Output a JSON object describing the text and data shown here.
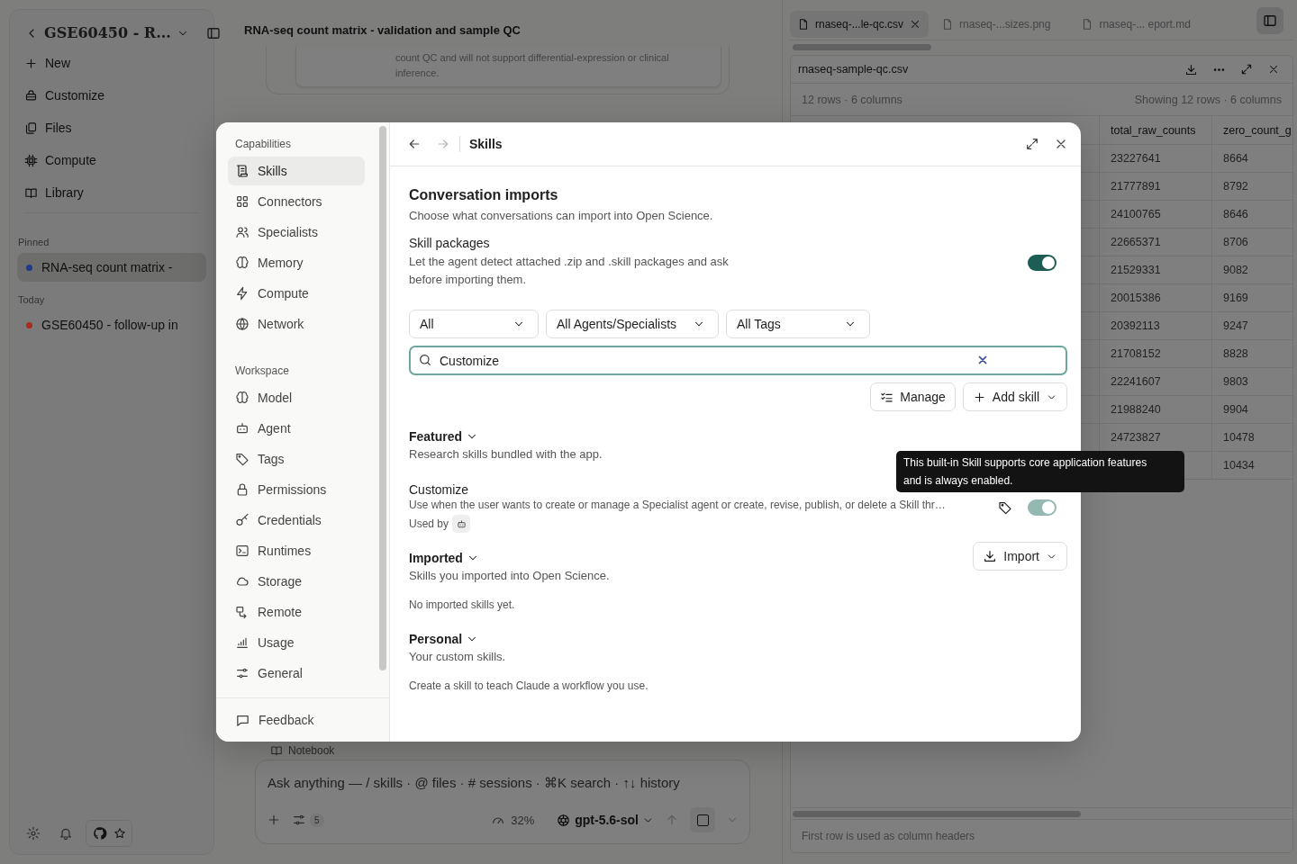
{
  "sidebar": {
    "workspace_title": "GSE60450 - R...",
    "nav": [
      "New",
      "Customize",
      "Files",
      "Compute",
      "Library"
    ],
    "sections": [
      {
        "title": "Pinned",
        "items": [
          {
            "label": "RNA-seq count matrix -",
            "color": "#1e3a8a",
            "selected": true
          }
        ]
      },
      {
        "title": "Today",
        "items": [
          {
            "label": "GSE60450 - follow-up in",
            "color": "#a82a22",
            "selected": false
          }
        ]
      }
    ]
  },
  "conversation": {
    "title": "RNA-seq count matrix - validation and sample QC",
    "card_text": "count QC and will not support differential-expression or clinical inference.",
    "notebook_label": "Notebook"
  },
  "composer": {
    "placeholder": "Ask anything — / skills · @ files · # sessions · ⌘K search · ↑↓ history",
    "tools_count": "5",
    "context_usage": "32%",
    "model": "gpt-5.6-sol"
  },
  "files": {
    "tabs": [
      {
        "label": "rnaseq-...le-qc.csv",
        "selected": true
      },
      {
        "label": "rnaseq-...sizes.png",
        "selected": false
      },
      {
        "label": "rnaseq-... eport.md",
        "selected": false
      }
    ],
    "viewer": {
      "filename": "rnaseq-sample-qc.csv",
      "summary": "12 rows · 6 columns",
      "showing": "Showing 12 rows · 6 columns",
      "columns": [
        "total_raw_counts",
        "zero_count_g"
      ],
      "rows": [
        [
          "23227641",
          "8664"
        ],
        [
          "21777891",
          "8792"
        ],
        [
          "24100765",
          "8646"
        ],
        [
          "22665371",
          "8706"
        ],
        [
          "21529331",
          "9082"
        ],
        [
          "20015386",
          "9169"
        ],
        [
          "20392113",
          "9247"
        ],
        [
          "21708152",
          "8828"
        ],
        [
          "22241607",
          "9803"
        ],
        [
          "21988240",
          "9904"
        ],
        [
          "24723827",
          "10478"
        ],
        [
          null,
          "10434"
        ]
      ],
      "footer": "First row is used as column headers"
    }
  },
  "settings_dialog": {
    "nav_sections": [
      {
        "title": "Capabilities",
        "items": [
          {
            "label": "Skills",
            "selected": true
          },
          {
            "label": "Connectors",
            "selected": false
          },
          {
            "label": "Specialists",
            "selected": false
          },
          {
            "label": "Memory",
            "selected": false
          },
          {
            "label": "Compute",
            "selected": false
          },
          {
            "label": "Network",
            "selected": false
          }
        ]
      },
      {
        "title": "Workspace",
        "items": [
          {
            "label": "Model",
            "selected": false
          },
          {
            "label": "Agent",
            "selected": false
          },
          {
            "label": "Tags",
            "selected": false
          },
          {
            "label": "Permissions",
            "selected": false
          },
          {
            "label": "Credentials",
            "selected": false
          },
          {
            "label": "Runtimes",
            "selected": false
          },
          {
            "label": "Storage",
            "selected": false
          },
          {
            "label": "Remote",
            "selected": false
          },
          {
            "label": "Usage",
            "selected": false
          },
          {
            "label": "General",
            "selected": false
          }
        ]
      }
    ],
    "footer_item": "Feedback",
    "title": "Skills",
    "imports": {
      "heading": "Conversation imports",
      "description": "Choose what conversations can import into Open Science.",
      "option": {
        "label": "Skill packages",
        "description": "Let the agent detect attached .zip and .skill packages and ask before importing them.",
        "on": true
      }
    },
    "filters": [
      "All",
      "All Agents/Specialists",
      "All Tags"
    ],
    "search": {
      "value": "Customize"
    },
    "actions": [
      "Manage",
      "Add skill"
    ],
    "sections": [
      {
        "title": "Featured",
        "expanded": true,
        "description": "Research skills bundled with the app.",
        "skills": [
          {
            "name": "Customize",
            "description": "Use when the user wants to create or manage a Specialist agent or create, revise, publish, or delete a Skill thr…",
            "used_by_label": "Used by",
            "on": true,
            "locked": true
          }
        ]
      },
      {
        "title": "Imported",
        "expanded": true,
        "description": "Skills you imported into Open Science.",
        "action": "Import",
        "empty_text": "No imported skills yet."
      },
      {
        "title": "Personal",
        "expanded": true,
        "description": "Your custom skills.",
        "empty_text": "Create a skill to teach Claude a workflow you use."
      }
    ],
    "tooltip": {
      "text": "This built-in Skill supports core application features and is always enabled."
    }
  }
}
